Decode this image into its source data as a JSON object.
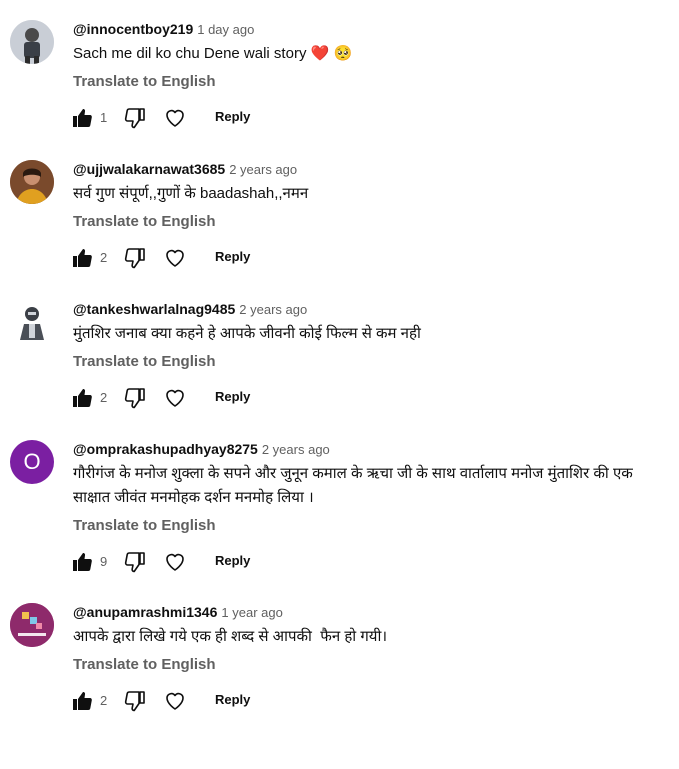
{
  "comments": [
    {
      "author": "@innocentboy219",
      "time": "1 day ago",
      "text": "Sach me dil ko chu Dene wali story ❤️ 🥺",
      "translate": "Translate to English",
      "likes": "1",
      "reply": "Reply",
      "avatar_color": "#d9dde3"
    },
    {
      "author": "@ujjwalakarnawat3685",
      "time": "2 years ago",
      "text": "सर्व गुण संपूर्ण,,गुणों के baadashah,,नमन",
      "translate": "Translate to English",
      "likes": "2",
      "reply": "Reply",
      "avatar_color": "#8a5a3a"
    },
    {
      "author": "@tankeshwarlalnag9485",
      "time": "2 years ago",
      "text": "मुंतशिर जनाब क्या कहने हे आपके जीवनी कोई फिल्म से कम नही",
      "translate": "Translate to English",
      "likes": "2",
      "reply": "Reply",
      "avatar_color": "#ffffff"
    },
    {
      "author": "@omprakashupadhyay8275",
      "time": "2 years ago",
      "text": "गौरीगंज के मनोज शुक्ला के सपने और जुनून कमाल के ऋचा जी के साथ वार्तालाप मनोज मुंताशिर की एक साक्षात जीवंत मनमोहक दर्शन मनमोह लिया ।",
      "translate": "Translate to English",
      "likes": "9",
      "reply": "Reply",
      "avatar_letter": "O",
      "avatar_color": "#7b1fa2"
    },
    {
      "author": "@anupamrashmi1346",
      "time": "1 year ago",
      "text": "आपके द्वारा लिखे गये एक ही शब्द से आपकी  फैन हो गयी।",
      "translate": "Translate to English",
      "likes": "2",
      "reply": "Reply",
      "avatar_color": "#8e2a6b"
    }
  ]
}
